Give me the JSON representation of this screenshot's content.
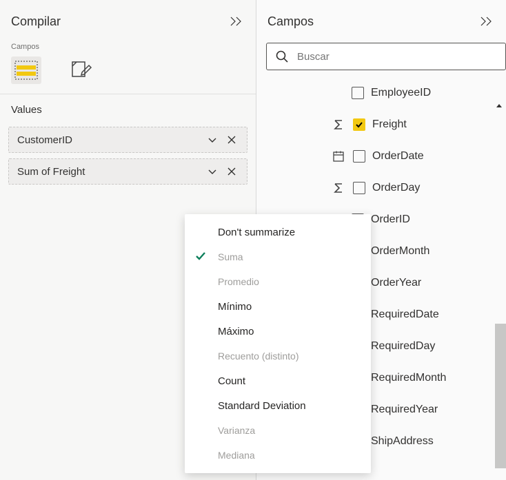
{
  "build": {
    "title": "Compilar",
    "subhead": "Campos",
    "values_label": "Values",
    "pills": [
      {
        "label": "CustomerID"
      },
      {
        "label": "Sum of Freight"
      }
    ]
  },
  "fields": {
    "title": "Campos",
    "search_placeholder": "Buscar",
    "items": [
      {
        "name": "EmployeeID",
        "checked": false,
        "icon": "none"
      },
      {
        "name": "Freight",
        "checked": true,
        "icon": "sigma"
      },
      {
        "name": "OrderDate",
        "checked": false,
        "icon": "calendar"
      },
      {
        "name": "OrderDay",
        "checked": false,
        "icon": "sigma"
      },
      {
        "name": "OrderID",
        "checked": false,
        "icon": "none"
      },
      {
        "name": "OrderMonth",
        "checked": false,
        "icon": "none"
      },
      {
        "name": "OrderYear",
        "checked": false,
        "icon": "none"
      },
      {
        "name": "RequiredDate",
        "checked": false,
        "icon": "none"
      },
      {
        "name": "RequiredDay",
        "checked": false,
        "icon": "none"
      },
      {
        "name": "RequiredMonth",
        "checked": false,
        "icon": "none"
      },
      {
        "name": "RequiredYear",
        "checked": false,
        "icon": "none"
      },
      {
        "name": "ShipAddress",
        "checked": false,
        "icon": "none"
      }
    ]
  },
  "menu": {
    "items": [
      {
        "label": "Don't summarize",
        "selected": false,
        "dim": false
      },
      {
        "label": "Suma",
        "selected": true,
        "dim": true
      },
      {
        "label": "Promedio",
        "selected": false,
        "dim": true
      },
      {
        "label": "Mínimo",
        "selected": false,
        "dim": false
      },
      {
        "label": "Máximo",
        "selected": false,
        "dim": false
      },
      {
        "label": "Recuento (distinto)",
        "selected": false,
        "dim": true
      },
      {
        "label": "Count",
        "selected": false,
        "dim": false
      },
      {
        "label": "Standard Deviation",
        "selected": false,
        "dim": false
      },
      {
        "label": "Varianza",
        "selected": false,
        "dim": true
      },
      {
        "label": "Mediana",
        "selected": false,
        "dim": true
      }
    ]
  }
}
